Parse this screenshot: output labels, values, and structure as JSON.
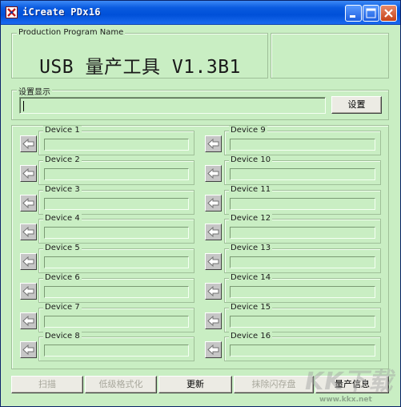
{
  "window": {
    "title": "iCreate PDx16"
  },
  "program_group": {
    "label": "Production Program Name",
    "headline": "USB 量产工具 V1.3B1"
  },
  "setting_group": {
    "label": "设置显示",
    "input_value": "",
    "button_label": "设置"
  },
  "devices": {
    "left": [
      {
        "label": "Device 1",
        "value": ""
      },
      {
        "label": "Device 2",
        "value": ""
      },
      {
        "label": "Device 3",
        "value": ""
      },
      {
        "label": "Device 4",
        "value": ""
      },
      {
        "label": "Device 5",
        "value": ""
      },
      {
        "label": "Device 6",
        "value": ""
      },
      {
        "label": "Device 7",
        "value": ""
      },
      {
        "label": "Device 8",
        "value": ""
      }
    ],
    "right": [
      {
        "label": "Device 9",
        "value": ""
      },
      {
        "label": "Device 10",
        "value": ""
      },
      {
        "label": "Device 11",
        "value": ""
      },
      {
        "label": "Device 12",
        "value": ""
      },
      {
        "label": "Device 13",
        "value": ""
      },
      {
        "label": "Device 14",
        "value": ""
      },
      {
        "label": "Device 15",
        "value": ""
      },
      {
        "label": "Device 16",
        "value": ""
      }
    ]
  },
  "bottom_buttons": [
    {
      "label": "扫描",
      "enabled": false
    },
    {
      "label": "低级格式化",
      "enabled": false
    },
    {
      "label": "更新",
      "enabled": true
    },
    {
      "label": "抹除闪存盘",
      "enabled": false
    },
    {
      "label": "量产信息",
      "enabled": true
    }
  ],
  "watermark": {
    "text": "KK下载",
    "url": "www.kkx.net"
  }
}
